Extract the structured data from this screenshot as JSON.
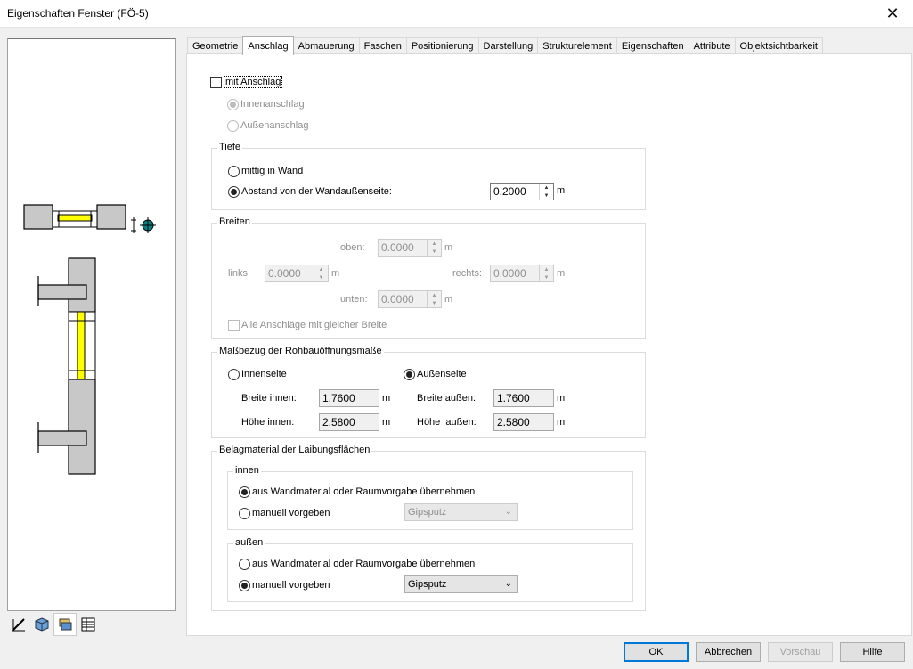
{
  "window": {
    "title": "Eigenschaften Fenster (FÖ-5)",
    "close_glyph": "✕"
  },
  "tabs": [
    {
      "label": "Geometrie",
      "active": false
    },
    {
      "label": "Anschlag",
      "active": true
    },
    {
      "label": "Abmauerung",
      "active": false
    },
    {
      "label": "Faschen",
      "active": false
    },
    {
      "label": "Positionierung",
      "active": false
    },
    {
      "label": "Darstellung",
      "active": false
    },
    {
      "label": "Strukturelement",
      "active": false
    },
    {
      "label": "Eigenschaften",
      "active": false
    },
    {
      "label": "Attribute",
      "active": false
    },
    {
      "label": "Objektsichtbarkeit",
      "active": false
    }
  ],
  "anschlag": {
    "checkbox_label": "mit Anschlag",
    "checked": false,
    "innen_label": "Innenanschlag",
    "aussen_label": "Außenanschlag"
  },
  "tiefe": {
    "title": "Tiefe",
    "mittig_label": "mittig in Wand",
    "abstand_label": "Abstand von der Wandaußenseite:",
    "abstand_value": "0.2000",
    "unit": "m"
  },
  "breiten": {
    "title": "Breiten",
    "oben_label": "oben:",
    "oben_value": "0.0000",
    "links_label": "links:",
    "links_value": "0.0000",
    "rechts_label": "rechts:",
    "rechts_value": "0.0000",
    "unten_label": "unten:",
    "unten_value": "0.0000",
    "unit": "m",
    "gleich_label": "Alle Anschläge mit gleicher Breite"
  },
  "massbezug": {
    "title": "Maßbezug der Rohbauöffnungsmaße",
    "innenseite_label": "Innenseite",
    "aussenseite_label": "Außenseite",
    "breite_innen_label": "Breite innen:",
    "breite_innen_value": "1.7600",
    "hoehe_innen_label": "Höhe innen:",
    "hoehe_innen_value": "2.5800",
    "breite_aussen_label": "Breite außen:",
    "breite_aussen_value": "1.7600",
    "hoehe_aussen_label": "Höhe  außen:",
    "hoehe_aussen_value": "2.5800",
    "unit": "m"
  },
  "belag": {
    "title": "Belagmaterial der Laibungsflächen",
    "innen": {
      "title": "innen",
      "uebernehmen_label": "aus Wandmaterial oder Raumvorgabe übernehmen",
      "manuell_label": "manuell vorgeben",
      "material": "Gipsputz"
    },
    "aussen": {
      "title": "außen",
      "uebernehmen_label": "aus Wandmaterial oder Raumvorgabe übernehmen",
      "manuell_label": "manuell vorgeben",
      "material": "Gipsputz"
    }
  },
  "buttons": {
    "ok": "OK",
    "abbrechen": "Abbrechen",
    "vorschau": "Vorschau",
    "hilfe": "Hilfe"
  },
  "toolbar": [
    "pen-ruler-icon",
    "cube-icon",
    "layers-icon",
    "table-icon"
  ],
  "colors": {
    "accent": "#0078d7",
    "wall": "#c8c8c8",
    "glass": "#ffff00",
    "marker": "#008080"
  }
}
